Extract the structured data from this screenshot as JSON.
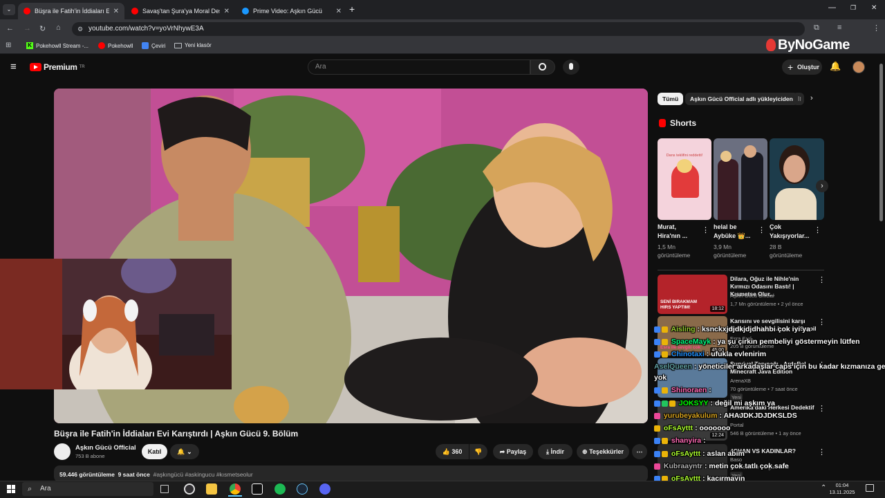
{
  "browser": {
    "tabs": [
      {
        "title": "Büşra ile Fatih'in İddiaları Evi Ka",
        "active": true,
        "favicon_color": "#ff0000"
      },
      {
        "title": "Savaş'tan Şura'ya Moral Desteği",
        "active": false,
        "favicon_color": "#ff0000"
      },
      {
        "title": "Prime Video: Aşkın Gücü",
        "active": false,
        "favicon_color": "#1a98ff"
      }
    ],
    "url": "youtube.com/watch?v=yoVrNhywE3A",
    "bookmarks": [
      "Pokehowll Stream -...",
      "Pokehowll",
      "Çeviri",
      "Yeni klasör"
    ]
  },
  "overlay_logo": "ByNoGame",
  "youtube": {
    "logo_text": "Premium",
    "logo_sup": "TR",
    "search_placeholder": "Ara",
    "create_label": "Oluştur"
  },
  "video": {
    "title": "Büşra ile Fatih'in İddiaları Evi Karıştırdı | Aşkın Gücü 9. Bölüm",
    "channel": "Aşkın Gücü Official",
    "subscribers": "753 B abone",
    "join_label": "Katıl",
    "likes": "360",
    "share_label": "Paylaş",
    "download_label": "İndir",
    "thanks_label": "Teşekkürler",
    "views": "59.446 görüntüleme",
    "age": "9 saat önce",
    "hashtags": "#aşkıngücü #askingucu #kısmetseolur"
  },
  "sidebar": {
    "chips": [
      "Tümü",
      "Aşkın Gücü Official adlı yükleyiciden",
      "İl"
    ],
    "shorts_heading": "Shorts",
    "shorts": [
      {
        "title": "Murat, Hira'nın ...",
        "views": "1,5 Mn görüntüleme",
        "thumb_text": "Dans teklifini reddetti!"
      },
      {
        "title": "helal be Aybüke 👑...",
        "views": "3,9 Mn görüntüleme"
      },
      {
        "title": "Çok Yakışıyorlar...",
        "views": "28 B görüntüleme"
      }
    ],
    "recommended": [
      {
        "title": "Dilara, Oğuz ile Nihle'nin Kırmızı Odasını Bastı! | Kısmetse Olur...",
        "channel": "Aşkın Gücü Official",
        "meta": "1,7 Mn görüntüleme • 2 yıl önce",
        "duration": "18:12",
        "thumb_text": "SENİ BIRAKMAM HIRS YAPTIM!"
      },
      {
        "title": "Karısını ve sevgilisini karşı karşıya getirdi... Ayşe ve Serpil yüzyüze geldi",
        "channel": "Esra Erol",
        "meta": "205 B görüntüleme",
        "duration": "45:00",
        "thumb_text": "Esra ile sevgili cok"
      },
      {
        "title": "Survival Tapınağı - ArdaBal Minecraft Java Edition",
        "channel": "ArenaXB",
        "meta": "70 görüntüleme • 7 saat önce",
        "badge": "Yeni"
      },
      {
        "title": "Amerika'daki Herkesi Dedektif Yaptı",
        "channel": "Portal",
        "meta": "546 B görüntüleme • 1 ay önce",
        "duration": "12:24"
      },
      {
        "title": "4CHAN VS KADINLAR?",
        "channel": "Baso",
        "meta": "görüntüleme • 1 gün önce",
        "badge": "Yeni"
      }
    ]
  },
  "chat": [
    {
      "user": "Aisling",
      "text": "ksnckxjdjdkjdjdhahbi çok iyi ya",
      "color": "#9acd32"
    },
    {
      "user": "SpaceMayk",
      "text": "ya şu çirkin pembeliyi göstermeyin lütfen",
      "color": "#00ff7f"
    },
    {
      "user": "Chinotaxi",
      "text": "ufukla evlenirim",
      "color": "#1e90ff"
    },
    {
      "user": "AselQueen",
      "text": "yöneticiler arkadaşlar caps için bu kadar kızmanıza gerek",
      "color": "#5f9ea0",
      "cont": "yok"
    },
    {
      "user": "Shinoraen",
      "text": "",
      "color": "#ff69b4"
    },
    {
      "user": "JOKSYY",
      "text": "değil mi aşkım ya",
      "color": "#00ff00"
    },
    {
      "user": "yurubeyakulum",
      "text": "AHAJDKJDJDKSLDS",
      "color": "#daa520"
    },
    {
      "user": "oFsAyttt",
      "text": "ooooooo",
      "color": "#adff2f"
    },
    {
      "user": "shanyira",
      "text": "",
      "color": "#ff69b4"
    },
    {
      "user": "oFsAyttt",
      "text": "aslan abim",
      "color": "#adff2f"
    },
    {
      "user": "Kubraayntr",
      "text": "metin çok tatlı çok safe",
      "color": "#b0b0b0"
    },
    {
      "user": "oFsAyttt",
      "text": "kaçırmayın",
      "color": "#adff2f"
    },
    {
      "user": "JOKSYY",
      "text": "",
      "color": "#00ff00"
    }
  ],
  "taskbar": {
    "search_placeholder": "Ara",
    "time": "01:04",
    "date": "13.11.2025"
  }
}
